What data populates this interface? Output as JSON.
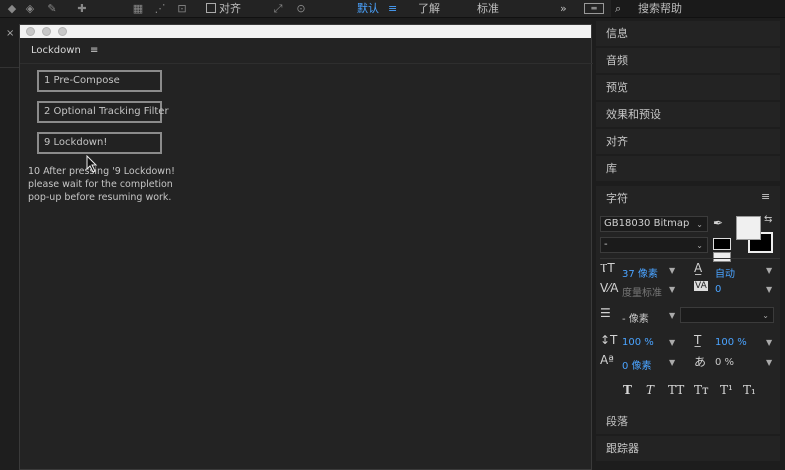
{
  "topbar": {
    "align_label": "对齐",
    "workspace_default": "默认",
    "workspace_learn": "了解",
    "workspace_standard": "标准",
    "overflow": "»",
    "search_placeholder": "搜索帮助"
  },
  "lockdown": {
    "panel_title": "Lockdown",
    "menu_glyph": "≡",
    "buttons": [
      "1 Pre-Compose",
      "2 Optional Tracking Filter",
      "9 Lockdown!"
    ],
    "note_lines": [
      "10 After pressing '9 Lockdown!",
      "please wait for the completion",
      "pop-up before resuming work."
    ]
  },
  "left": {
    "close": "×"
  },
  "right_panels": {
    "info": "信息",
    "audio": "音频",
    "preview": "预览",
    "effects": "效果和预设",
    "align": "对齐",
    "library": "库",
    "character": "字符",
    "paragraph": "段落",
    "tracker": "跟踪器"
  },
  "character": {
    "menu_glyph": "≡",
    "font_family": "GB18030 Bitmap",
    "font_style": "-",
    "font_size": "37 像素",
    "leading": "自动",
    "kerning": "度量标准",
    "tracking": "0",
    "stroke_width": "- 像素",
    "vert_scale": "100 %",
    "horiz_scale": "100 %",
    "baseline_shift": "0 像素",
    "tsume": "0 %",
    "style_buttons": [
      "T",
      "T",
      "TT",
      "Tт",
      "T¹",
      "T₁"
    ],
    "fill_color": "#f0f0f0",
    "stroke_color": "#000000"
  }
}
